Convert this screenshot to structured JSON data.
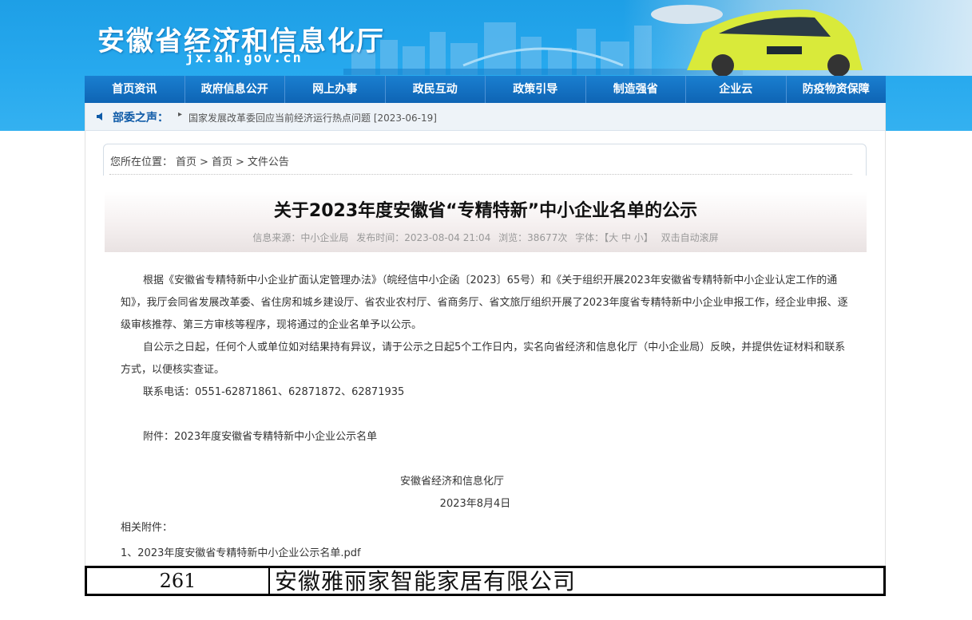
{
  "header": {
    "site_title": "安徽省经济和信息化厅",
    "site_domain": "jx.ah.gov.cn"
  },
  "nav": {
    "items": [
      "首页资讯",
      "政府信息公开",
      "网上办事",
      "政民互动",
      "政策引导",
      "制造强省",
      "企业云",
      "防疫物资保障"
    ]
  },
  "notice": {
    "label": "部委之声：",
    "arrow": "▸",
    "message": "国家发展改革委回应当前经济运行热点问题 [2023-06-19]"
  },
  "breadcrumb": {
    "prefix": "您所在位置：",
    "items": [
      "首页",
      "首页",
      "文件公告"
    ],
    "separator": ">"
  },
  "article": {
    "title": "关于2023年度安徽省“专精特新”中小企业名单的公示",
    "meta": {
      "source": "信息来源：中小企业局",
      "time": "发布时间：2023-08-04 21:04",
      "views": "浏览：38677次",
      "font_label": "字体：【大 中 小】",
      "autoscroll": "双击自动滚屏"
    },
    "para1": "根据《安徽省专精特新中小企业扩面认定管理办法》（皖经信中小企函〔2023〕65号）和《关于组织开展2023年安徽省专精特新中小企业认定工作的通知》，我厅会同省发展改革委、省住房和城乡建设厅、省农业农村厅、省商务厅、省文旅厅组织开展了2023年度省专精特新中小企业申报工作，经企业申报、逐级审核推荐、第三方审核等程序，现将通过的企业名单予以公示。",
    "para2": "自公示之日起，任何个人或单位如对结果持有异议，请于公示之日起5个工作日内，实名向省经济和信息化厅（中小企业局）反映，并提供佐证材料和联系方式，以便核实查证。",
    "contact": "联系电话：0551-62871861、62871872、62871935",
    "attachment_note": "附件：2023年度安徽省专精特新中小企业公示名单",
    "signature_org": "安徽省经济和信息化厅",
    "signature_date": "2023年8月4日",
    "related_label": "相关附件：",
    "related_file": "1、2023年度安徽省专精特新中小企业公示名单.pdf"
  },
  "table_row": {
    "number": "261",
    "company": "安徽雅丽家智能家居有限公司"
  }
}
